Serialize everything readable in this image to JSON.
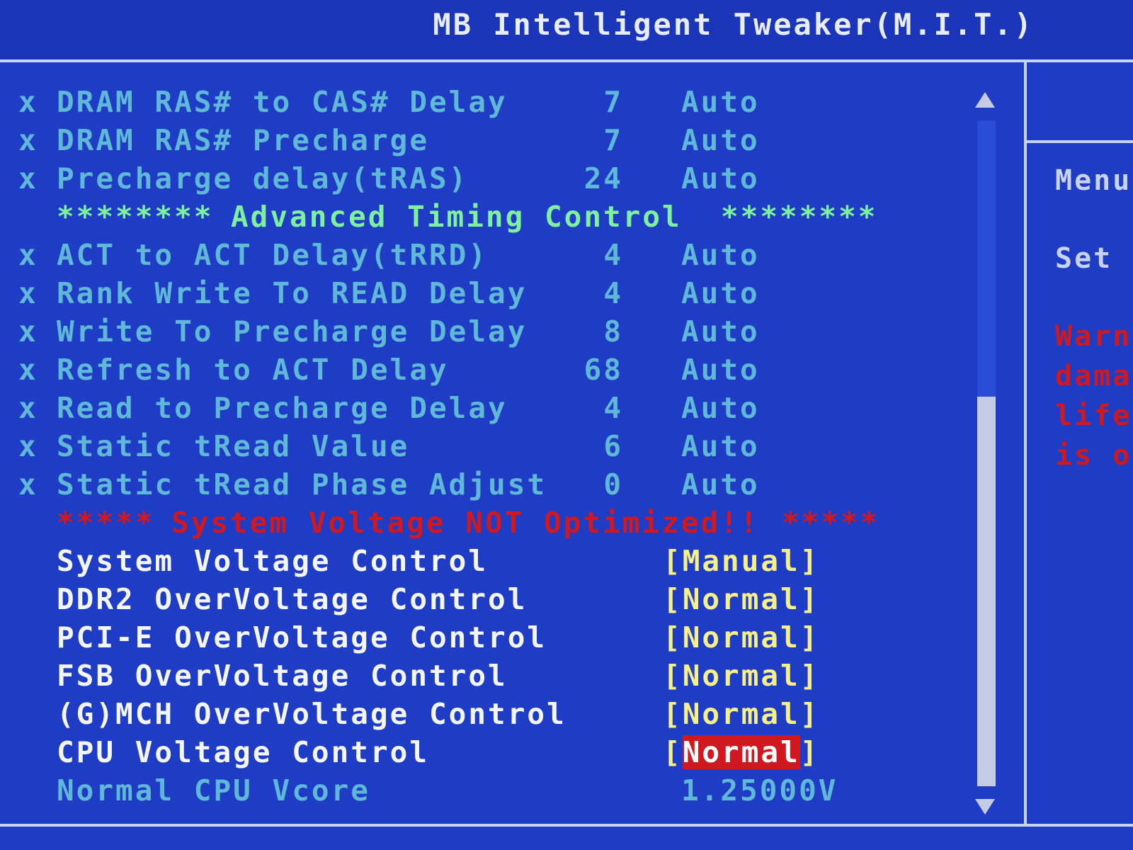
{
  "header": {
    "title": "MB Intelligent Tweaker(M.I.T.)"
  },
  "locked_rows": [
    {
      "label": "DRAM RAS# to CAS# Delay",
      "value": "7",
      "setting": "Auto"
    },
    {
      "label": "DRAM RAS# Precharge",
      "value": "7",
      "setting": "Auto"
    },
    {
      "label": "Precharge delay(tRAS)",
      "value": "24",
      "setting": "Auto"
    }
  ],
  "advanced_header": {
    "stars_left": "********",
    "text": "Advanced Timing Control",
    "stars_right": "********"
  },
  "advanced_rows": [
    {
      "label": "ACT to ACT Delay(tRRD)",
      "value": "4",
      "setting": "Auto"
    },
    {
      "label": "Rank Write To READ Delay",
      "value": "4",
      "setting": "Auto"
    },
    {
      "label": "Write To Precharge Delay",
      "value": "8",
      "setting": "Auto"
    },
    {
      "label": "Refresh to ACT Delay",
      "value": "68",
      "setting": "Auto"
    },
    {
      "label": "Read to Precharge Delay",
      "value": "4",
      "setting": "Auto"
    },
    {
      "label": "Static tRead Value",
      "value": "6",
      "setting": "Auto"
    },
    {
      "label": "Static tRead Phase Adjust",
      "value": "0",
      "setting": "Auto"
    }
  ],
  "locked_marker": "x",
  "voltage_warning": {
    "stars_left": "*****",
    "text": "System Voltage NOT Optimized!!",
    "stars_right": "*****"
  },
  "voltage_rows": [
    {
      "label": "System Voltage Control",
      "value": "Manual"
    },
    {
      "label": "DDR2 OverVoltage Control",
      "value": "Normal"
    },
    {
      "label": "PCI-E OverVoltage Control",
      "value": "Normal"
    },
    {
      "label": "FSB OverVoltage Control",
      "value": "Normal"
    },
    {
      "label": "(G)MCH OverVoltage Control",
      "value": "Normal"
    },
    {
      "label": "CPU Voltage Control",
      "value": "Normal"
    }
  ],
  "vcore": {
    "label": "Normal CPU Vcore",
    "value": "1.25000V"
  },
  "help_panel": {
    "menu": "Menu",
    "set": "Set",
    "warning_lines": [
      "Warn",
      "dama",
      "life",
      "is o"
    ]
  },
  "colors": {
    "background": "#1f3cc4",
    "disabled_text": "#5fb8d8",
    "option_text": "#f4f6ff",
    "value_text": "#f6f08a",
    "section_header": "#7ef0a0",
    "warning": "#d01820"
  }
}
